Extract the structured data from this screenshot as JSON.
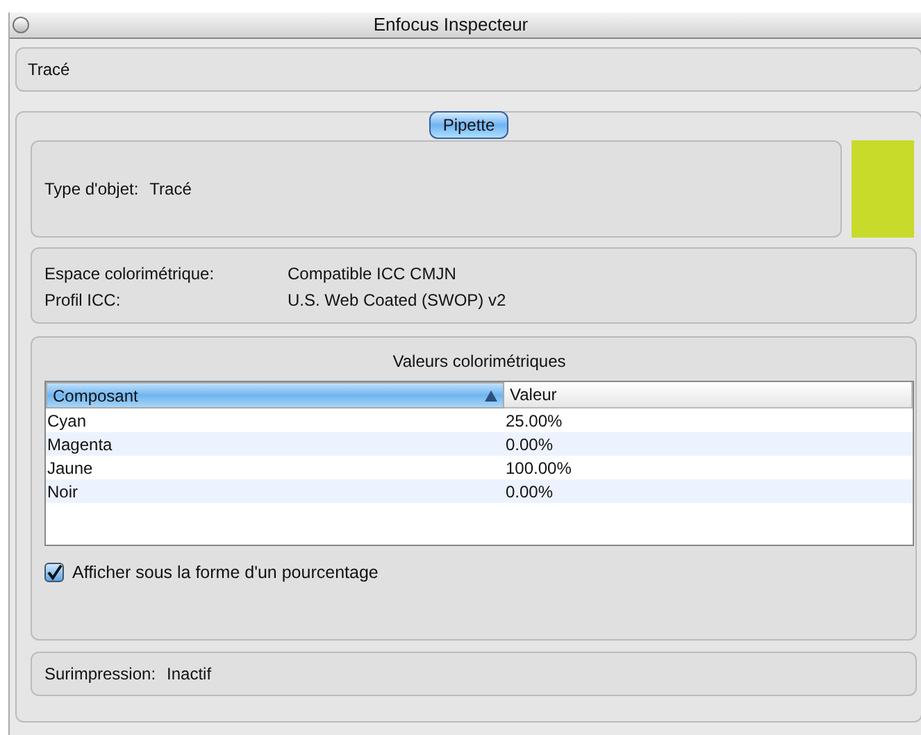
{
  "window": {
    "title": "Enfocus Inspecteur"
  },
  "object_header": {
    "label": "Tracé"
  },
  "mode_button": {
    "label": "Pipette"
  },
  "object_type": {
    "label": "Type d'objet:",
    "value": "Tracé",
    "color": "#c8da2a"
  },
  "color_space": [
    {
      "label": "Espace colorimétrique:",
      "value": "Compatible ICC CMJN"
    },
    {
      "label": "Profil ICC:",
      "value": "U.S. Web Coated (SWOP) v2"
    }
  ],
  "color_values": {
    "title": "Valeurs colorimétriques",
    "columns": [
      {
        "label": "Composant",
        "selected": true
      },
      {
        "label": "Valeur",
        "selected": false
      }
    ],
    "rows": [
      [
        "Cyan",
        "25.00%"
      ],
      [
        "Magenta",
        "0.00%"
      ],
      [
        "Jaune",
        "100.00%"
      ],
      [
        "Noir",
        "0.00%"
      ]
    ],
    "percentage_checkbox": {
      "label": "Afficher sous la forme d'un pourcentage",
      "checked": true
    }
  },
  "overprint": {
    "label": "Surimpression:",
    "value": "Inactif"
  }
}
